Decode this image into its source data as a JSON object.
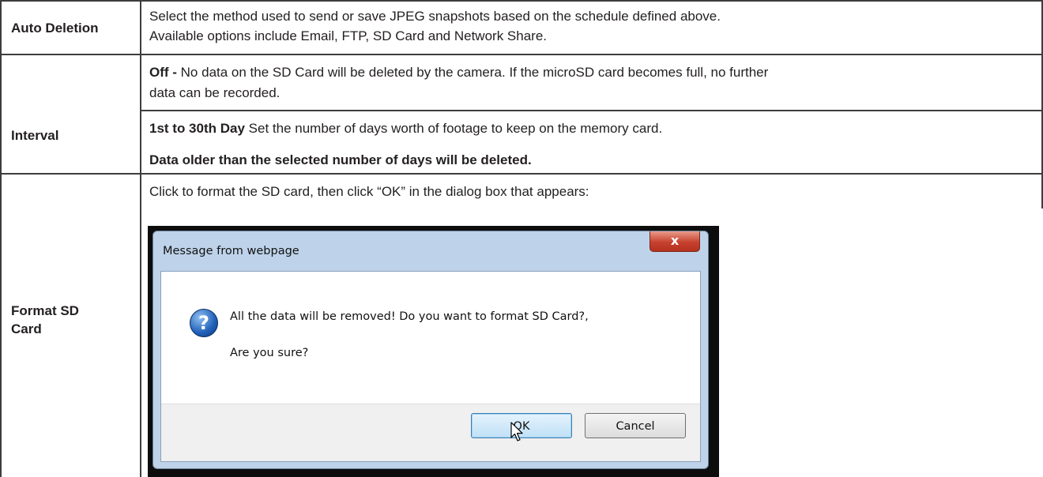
{
  "rows": {
    "auto_deletion": {
      "label": "Auto Deletion",
      "line1": "Select the method used to send or save JPEG snapshots based on the schedule defined above.",
      "line2": "Available options include Email, FTP, SD Card and Network Share."
    },
    "interval": {
      "label": "Interval",
      "off_term": "Off - ",
      "off_line1": "No data on the SD Card will be deleted by the camera. If the microSD card becomes full, no further",
      "off_line2": "data can be recorded.",
      "days_term": "1st to 30th Day",
      "days_text": " Set the number of days worth of footage to keep on the memory card.",
      "days_note": "Data older than the selected number of days will be deleted."
    },
    "format_sd": {
      "label_line1": "Format SD",
      "label_line2": "Card",
      "instruction": "Click to format the SD card, then click “OK” in the dialog box that appears:"
    }
  },
  "dialog": {
    "title": "Message from webpage",
    "close_glyph": "x",
    "icon_glyph": "?",
    "message_line1": "All the data will be removed! Do you want to format SD Card?,",
    "message_line2": "Are you sure?",
    "ok_label": "OK",
    "cancel_label": "Cancel"
  }
}
